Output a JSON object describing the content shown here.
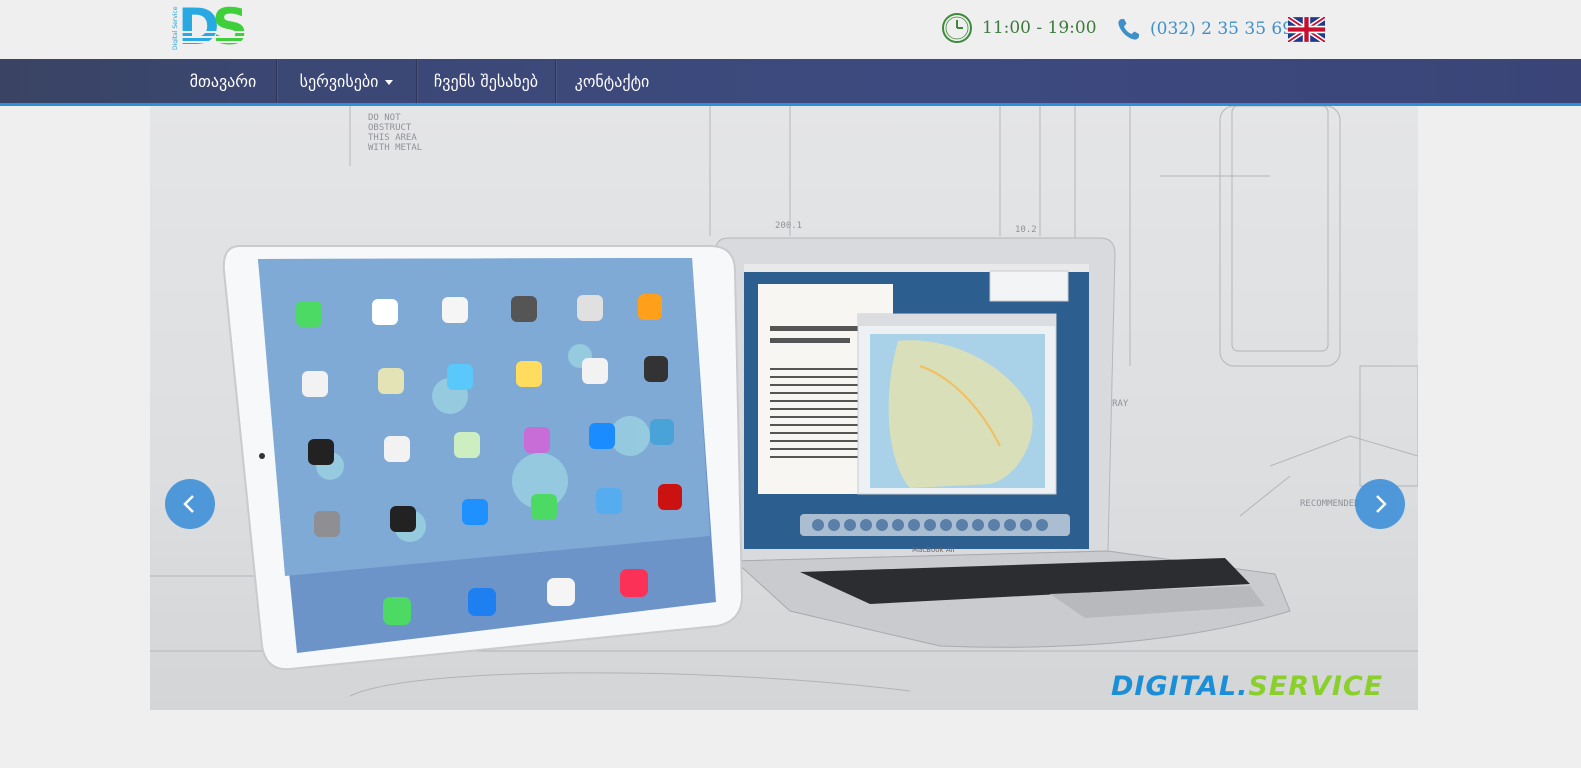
{
  "header": {
    "logo_text": "DS",
    "logo_small_text": "Digital Service",
    "hours": "11:00 - 19:00",
    "phone": "(032) 2 35 35 69",
    "language_flag": "uk-flag-icon"
  },
  "nav": {
    "items": [
      {
        "label": "მთავარი"
      },
      {
        "label": "სერვისები"
      },
      {
        "label": "ჩვენს შესახებ"
      },
      {
        "label": "კონტაქტი"
      }
    ]
  },
  "slider": {
    "brand_part1": "DIGITAL.",
    "brand_part2": "SERVICE",
    "prev_icon": "chevron-left-icon",
    "next_icon": "chevron-right-icon"
  },
  "colors": {
    "nav_bg": "#3c4878",
    "nav_border": "#2f8fd6",
    "arrow": "#3b8fd9",
    "hours_text": "#3d7a3d",
    "phone_text": "#3f8fc9"
  }
}
